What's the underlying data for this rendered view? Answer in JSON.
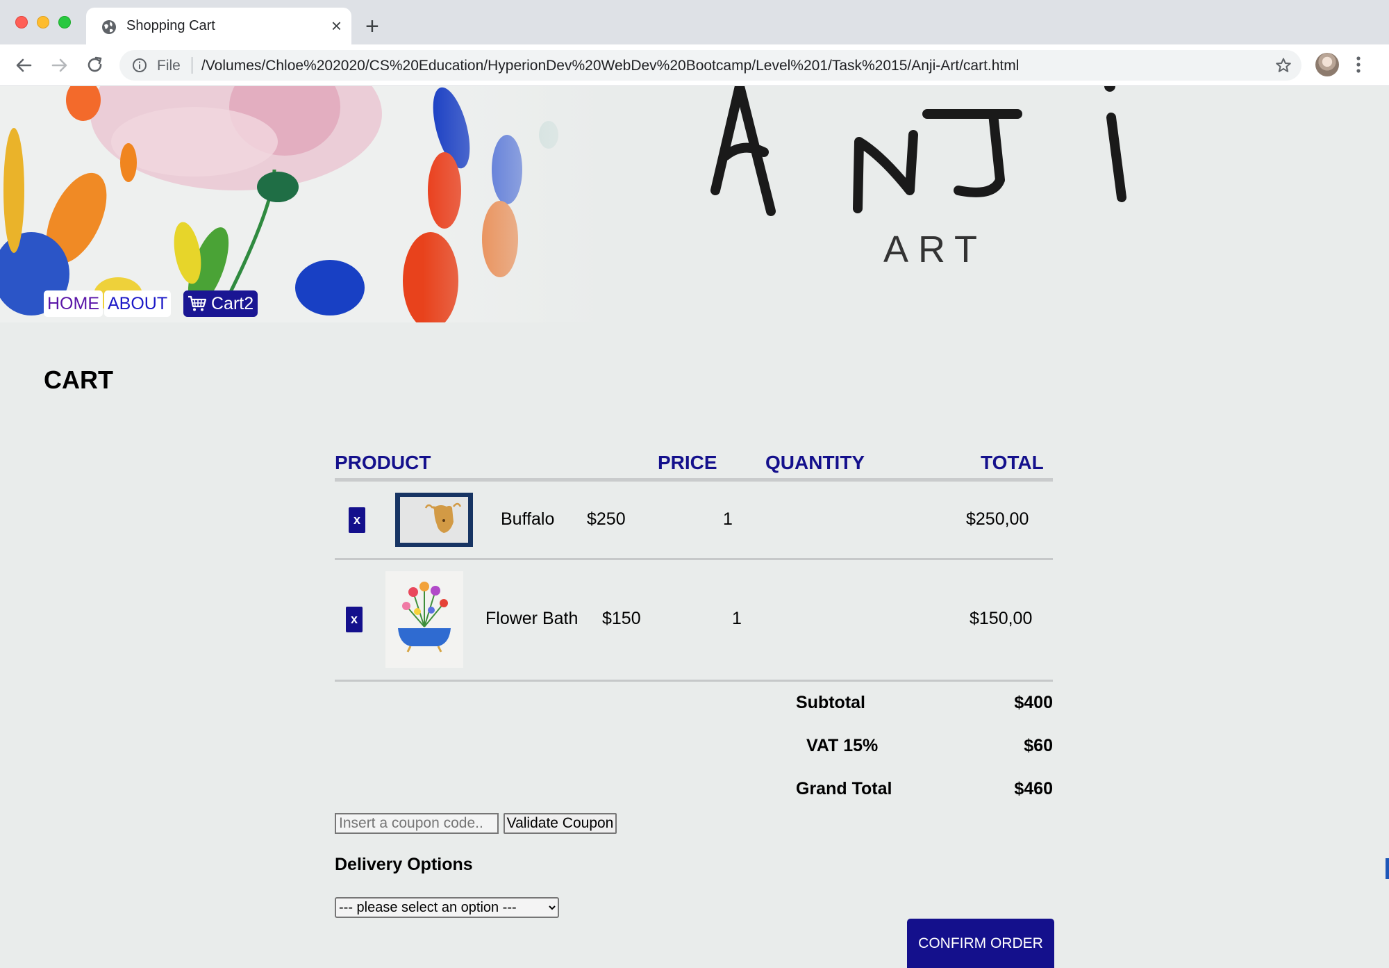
{
  "browser": {
    "tab_title": "Shopping Cart",
    "new_tab_symbol": "+",
    "close_symbol": "×",
    "file_label": "File",
    "url": "/Volumes/Chloe%202020/CS%20Education/HyperionDev%20WebDev%20Bootcamp/Level%201/Task%2015/Anji-Art/cart.html"
  },
  "header": {
    "logo_text": "ANJi",
    "logo_subtext": "ART",
    "nav": {
      "home": "HOME",
      "about": "ABOUT",
      "cart": "Cart2"
    }
  },
  "cart": {
    "title": "CART",
    "columns": {
      "product": "PRODUCT",
      "price": "PRICE",
      "quantity": "QUANTITY",
      "total": "TOTAL"
    },
    "items": [
      {
        "remove_label": "x",
        "name": "Buffalo",
        "price": "$250",
        "quantity": "1",
        "total": "$250,00"
      },
      {
        "remove_label": "x",
        "name": "Flower Bath",
        "price": "$150",
        "quantity": "1",
        "total": "$150,00"
      }
    ],
    "summary": {
      "subtotal_label": "Subtotal",
      "subtotal_value": "$400",
      "vat_label": "VAT 15%",
      "vat_value": "$60",
      "grand_total_label": "Grand Total",
      "grand_total_value": "$460"
    },
    "coupon": {
      "placeholder": "Insert a coupon code..",
      "button_label": "Validate Coupon"
    },
    "delivery": {
      "title": "Delivery Options",
      "selected_option": "--- please select an option ---"
    },
    "confirm_label": "CONFIRM ORDER"
  },
  "colors": {
    "accent": "#14108c",
    "page_background": "#e9eceb"
  }
}
